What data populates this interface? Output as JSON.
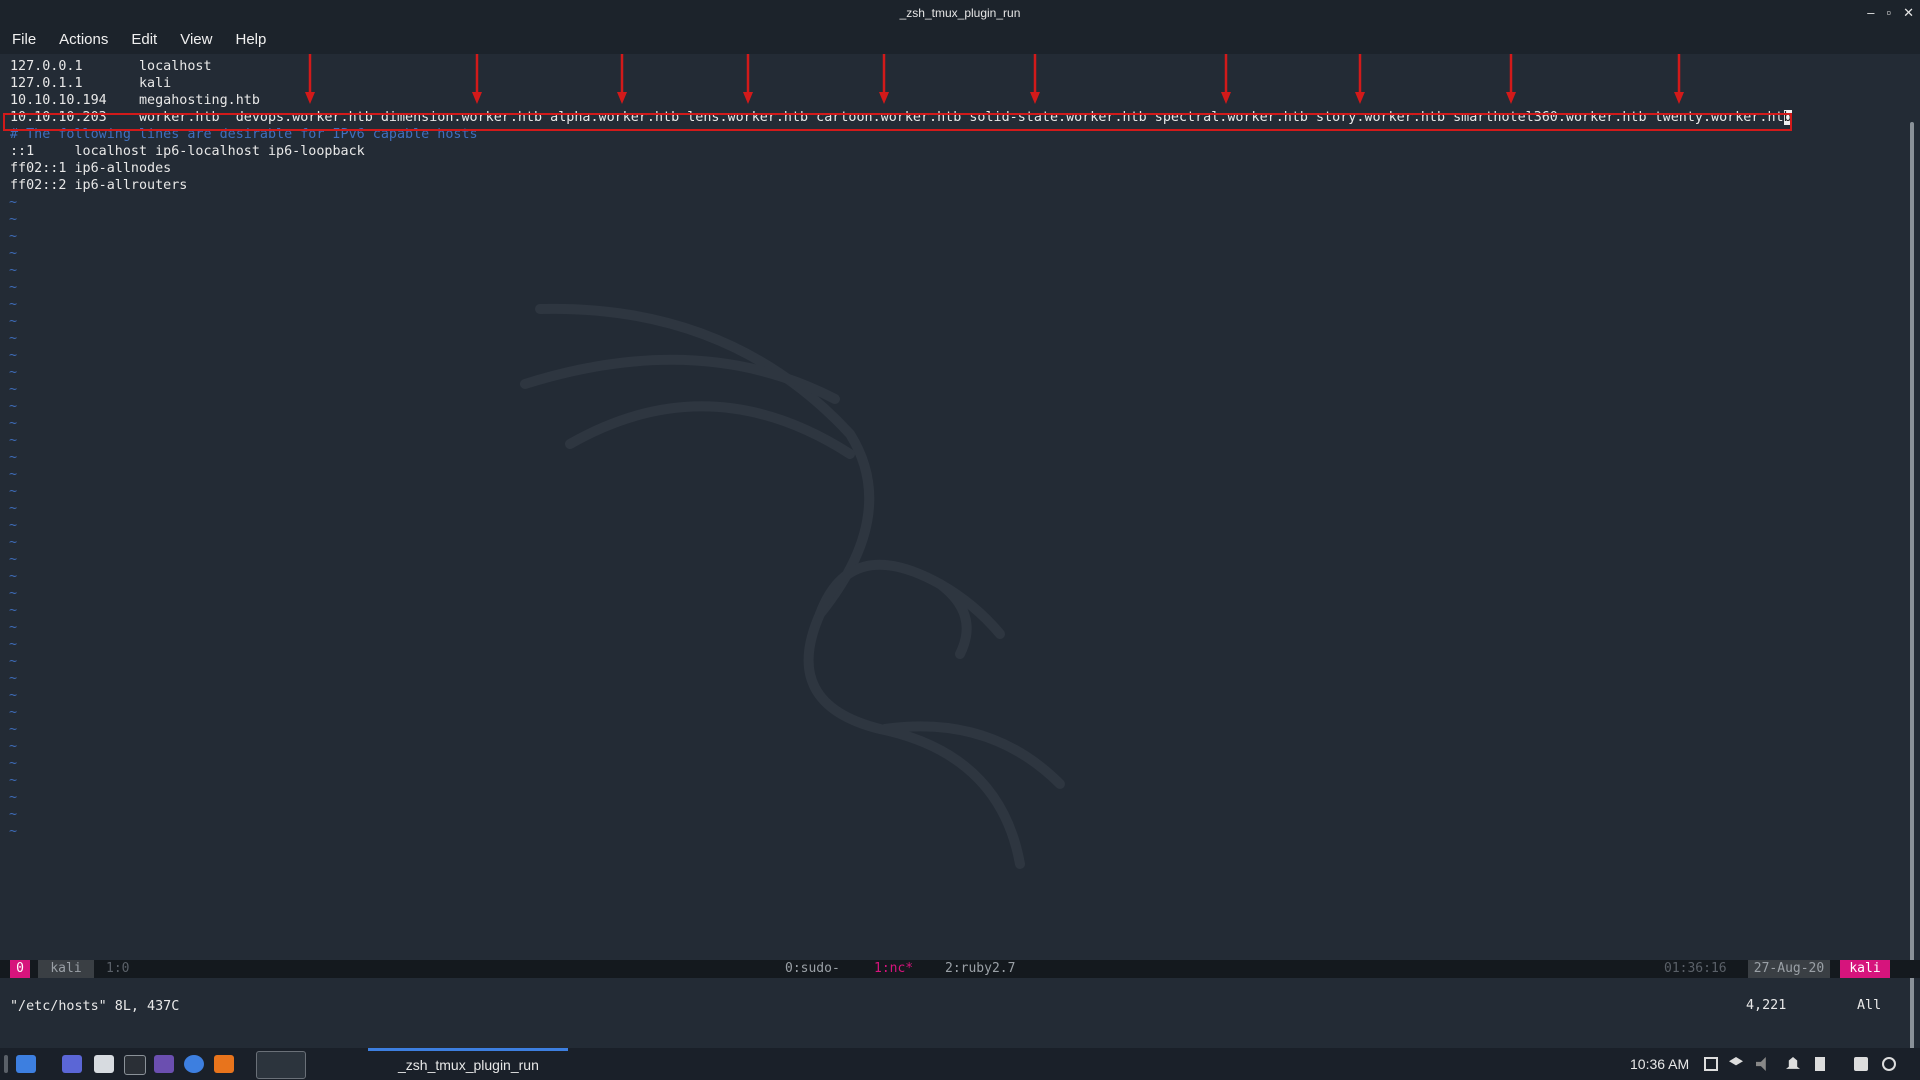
{
  "window": {
    "title": "_zsh_tmux_plugin_run",
    "controls": [
      "–",
      "▫",
      "✕"
    ]
  },
  "menu": [
    "File",
    "Actions",
    "Edit",
    "View",
    "Help"
  ],
  "hosts_lines": [
    "127.0.0.1       localhost",
    "127.0.1.1       kali",
    "10.10.10.194    megahosting.htb",
    "10.10.10.203    worker.htb  devops.worker.htb dimension.worker.htb alpha.worker.htb lens.worker.htb cartoon.worker.htb solid-state.worker.htb spectral.worker.htb story.worker.htb smarthotel360.worker.htb twenty.worker.ht",
    "# The following lines are desirable for IPv6 capable hosts",
    "::1     localhost ip6-localhost ip6-loopback",
    "ff02::1 ip6-allnodes",
    "ff02::2 ip6-allrouters"
  ],
  "cursor_char": "b",
  "tilde": "~",
  "vim_status": {
    "file": "\"/etc/hosts\" 8L, 437C",
    "position": "4,221",
    "scroll": "All"
  },
  "tmux": {
    "session_index": "0",
    "session_name": "kali",
    "pane": "1:0",
    "windows": [
      "0:sudo-",
      "1:nc*",
      "2:ruby2.7"
    ],
    "time": "01:36:16",
    "date": "27-Aug-20",
    "host": "kali"
  },
  "taskbar": {
    "task_label": "_zsh_tmux_plugin_run",
    "clock": "10:36 AM"
  },
  "colors": {
    "highlight_box": "#d21a1a",
    "arrow": "#d21a1a",
    "tmux_pink": "#d6147c",
    "comment": "#3f6fbf"
  }
}
